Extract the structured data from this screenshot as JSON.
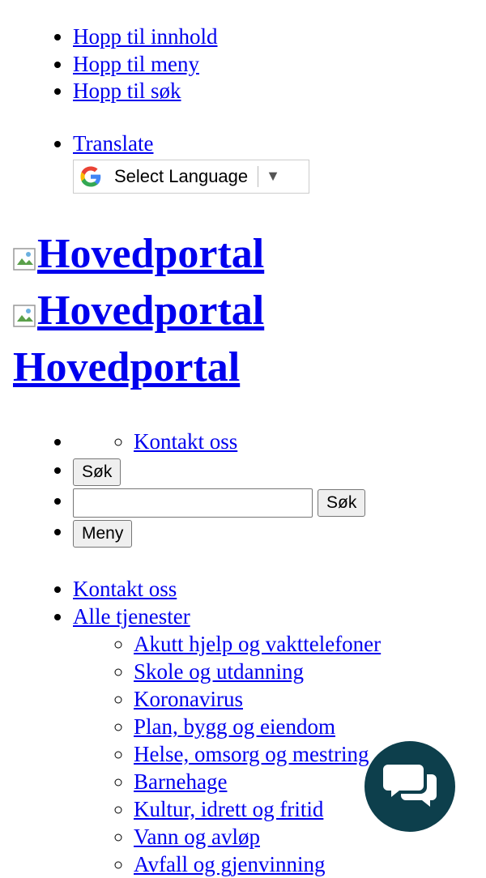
{
  "skip_links": [
    "Hopp til innhold",
    "Hopp til meny",
    "Hopp til søk"
  ],
  "translate": {
    "link_label": "Translate",
    "select_label": "Select Language",
    "arrow": "▼",
    "logo_icon": "google-g-icon"
  },
  "logo": {
    "alt_text": "Hovedportal",
    "text": "Hovedportal"
  },
  "header_nav": {
    "contact_label": "Kontakt oss",
    "search_toggle_label": "Søk",
    "search_input_value": "",
    "search_submit_label": "Søk",
    "menu_label": "Meny"
  },
  "main_nav": {
    "contact_label": "Kontakt oss",
    "all_services_label": "Alle tjenester",
    "services": [
      "Akutt hjelp og vakttelefoner",
      "Skole og utdanning",
      "Koronavirus",
      "Plan, bygg og eiendom",
      "Helse, omsorg og mestring",
      "Barnehage",
      "Kultur, idrett og fritid",
      "Vann og avløp",
      "Avfall og gjenvinning"
    ]
  },
  "chat": {
    "icon": "chat-bubbles-icon",
    "color": "#0d3f4c"
  },
  "colors": {
    "link": "#0000ee"
  }
}
